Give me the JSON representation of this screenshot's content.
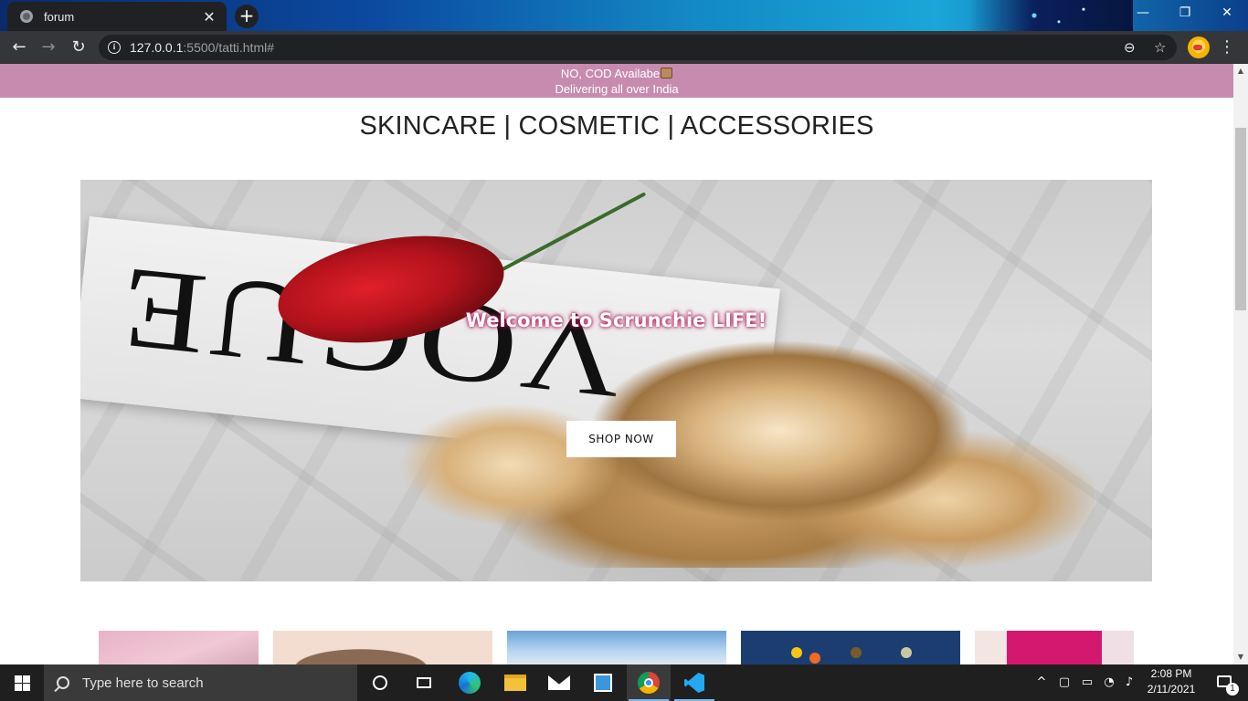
{
  "browser": {
    "tab_title": "forum",
    "tab_close": "✕",
    "new_tab": "+",
    "url_host": "127.0.0.1",
    "url_rest": ":5500/tatti.html#",
    "window_controls": {
      "minimize": "—",
      "restore": "❐",
      "close": "✕"
    },
    "nav": {
      "back": "←",
      "forward": "→",
      "reload": "↻"
    },
    "zoom_icon": "⊖",
    "star_icon": "☆",
    "menu_icon": "⋮"
  },
  "page": {
    "announcement_line1": "NO, COD Availabe",
    "announcement_line2": "Delivering all over India",
    "categories": "SKINCARE | COSMETIC | ACCESSORIES",
    "hero": {
      "title": "Welcome to Scrunchie LIFE!",
      "cta": "SHOP NOW",
      "magazine_text": "VOGUE"
    }
  },
  "taskbar": {
    "search_placeholder": "Type here to search",
    "time": "2:08 PM",
    "date": "2/11/2021",
    "notification_count": "1",
    "tray_chevron": "^"
  },
  "colors": {
    "announcement_bg": "#c78bb0",
    "hero_title_glow": "#c2185b",
    "browser_toolbar": "#35363a",
    "taskbar_bg": "#1f1f1f"
  }
}
